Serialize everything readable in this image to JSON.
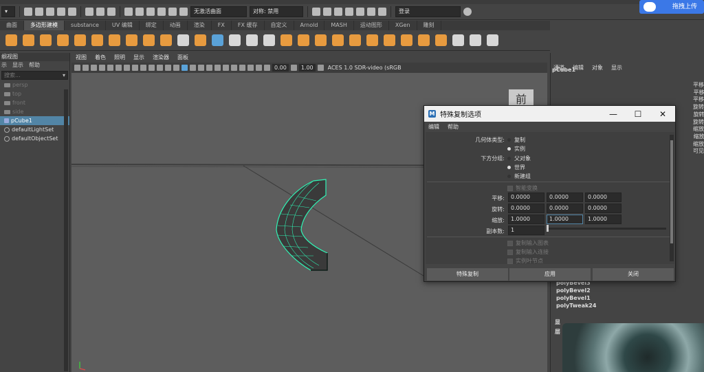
{
  "toolbar": {
    "active_curve_label": "无激活曲面",
    "symmetry_label": "对称: 禁用",
    "login_label": "登录"
  },
  "upload_widget": {
    "label": "拖拽上传"
  },
  "shelf": {
    "tabs": [
      {
        "label": "曲面",
        "active": false
      },
      {
        "label": "多边形建模",
        "active": true
      },
      {
        "label": "substance",
        "active": false
      },
      {
        "label": "UV 编辑",
        "active": false
      },
      {
        "label": "绑定",
        "active": false
      },
      {
        "label": "动画",
        "active": false
      },
      {
        "label": "渲染",
        "active": false
      },
      {
        "label": "FX",
        "active": false
      },
      {
        "label": "FX 缓存",
        "active": false
      },
      {
        "label": "自定义",
        "active": false
      },
      {
        "label": "Arnold",
        "active": false
      },
      {
        "label": "MASH",
        "active": false
      },
      {
        "label": "运动图形",
        "active": false
      },
      {
        "label": "XGen",
        "active": false
      },
      {
        "label": "雕刻",
        "active": false
      }
    ]
  },
  "outliner": {
    "title": "纲视图",
    "menu": [
      "示",
      "显示",
      "帮助"
    ],
    "search_placeholder": "搜索...",
    "items": [
      {
        "label": "persp",
        "kind": "camera",
        "dim": true,
        "selected": false
      },
      {
        "label": "top",
        "kind": "camera",
        "dim": true,
        "selected": false
      },
      {
        "label": "front",
        "kind": "camera",
        "dim": true,
        "selected": false
      },
      {
        "label": "side",
        "kind": "camera",
        "dim": true,
        "selected": false
      },
      {
        "label": "pCube1",
        "kind": "mesh",
        "dim": false,
        "selected": true
      },
      {
        "label": "defaultLightSet",
        "kind": "set",
        "dim": false,
        "selected": false
      },
      {
        "label": "defaultObjectSet",
        "kind": "set",
        "dim": false,
        "selected": false
      }
    ]
  },
  "viewport": {
    "menu": [
      "视图",
      "着色",
      "照明",
      "显示",
      "渲染器",
      "面板"
    ],
    "exposure": "0.00",
    "gamma": "1.00",
    "color_space": "ACES 1.0 SDR-video (sRGB",
    "viewcube_label": "前"
  },
  "channel_box": {
    "menu": [
      "通道",
      "编辑",
      "对象",
      "显示"
    ],
    "object": "pCube1",
    "attributes": [
      "平移 X",
      "平移 Y",
      "平移 Z",
      "旋转 X",
      "旋转 Y",
      "旋转 Z",
      "缩放 X",
      "缩放 Y",
      "缩放 Z",
      "可见性"
    ],
    "history": [
      "polyBevel3",
      "polyBevel2",
      "polyBevel1",
      "polyTweak24"
    ],
    "layer_labels": [
      "显",
      "层"
    ]
  },
  "dialog": {
    "title": "特殊复制选项",
    "menu": [
      "编辑",
      "帮助"
    ],
    "geometry_type_label": "几何体类型:",
    "geometry_options": [
      {
        "label": "复制",
        "selected": false
      },
      {
        "label": "实例",
        "selected": true
      }
    ],
    "group_under_label": "下方分组:",
    "group_options": [
      {
        "label": "父对象",
        "selected": false
      },
      {
        "label": "世界",
        "selected": true
      },
      {
        "label": "新建组",
        "selected": false
      }
    ],
    "smart_transform_label": "智能变换",
    "translate_label": "平移:",
    "rotate_label": "旋转:",
    "scale_label": "缩放:",
    "translate": [
      "0.0000",
      "0.0000",
      "0.0000"
    ],
    "rotate": [
      "0.0000",
      "0.0000",
      "0.0000"
    ],
    "scale": [
      "1.0000",
      "1.0000",
      "1.0000"
    ],
    "copies_label": "副本数:",
    "copies": "1",
    "checkboxes": [
      "复制输入图表",
      "复制输入连接",
      "实例叶节点"
    ],
    "buttons": [
      "特殊复制",
      "应用",
      "关闭"
    ]
  }
}
